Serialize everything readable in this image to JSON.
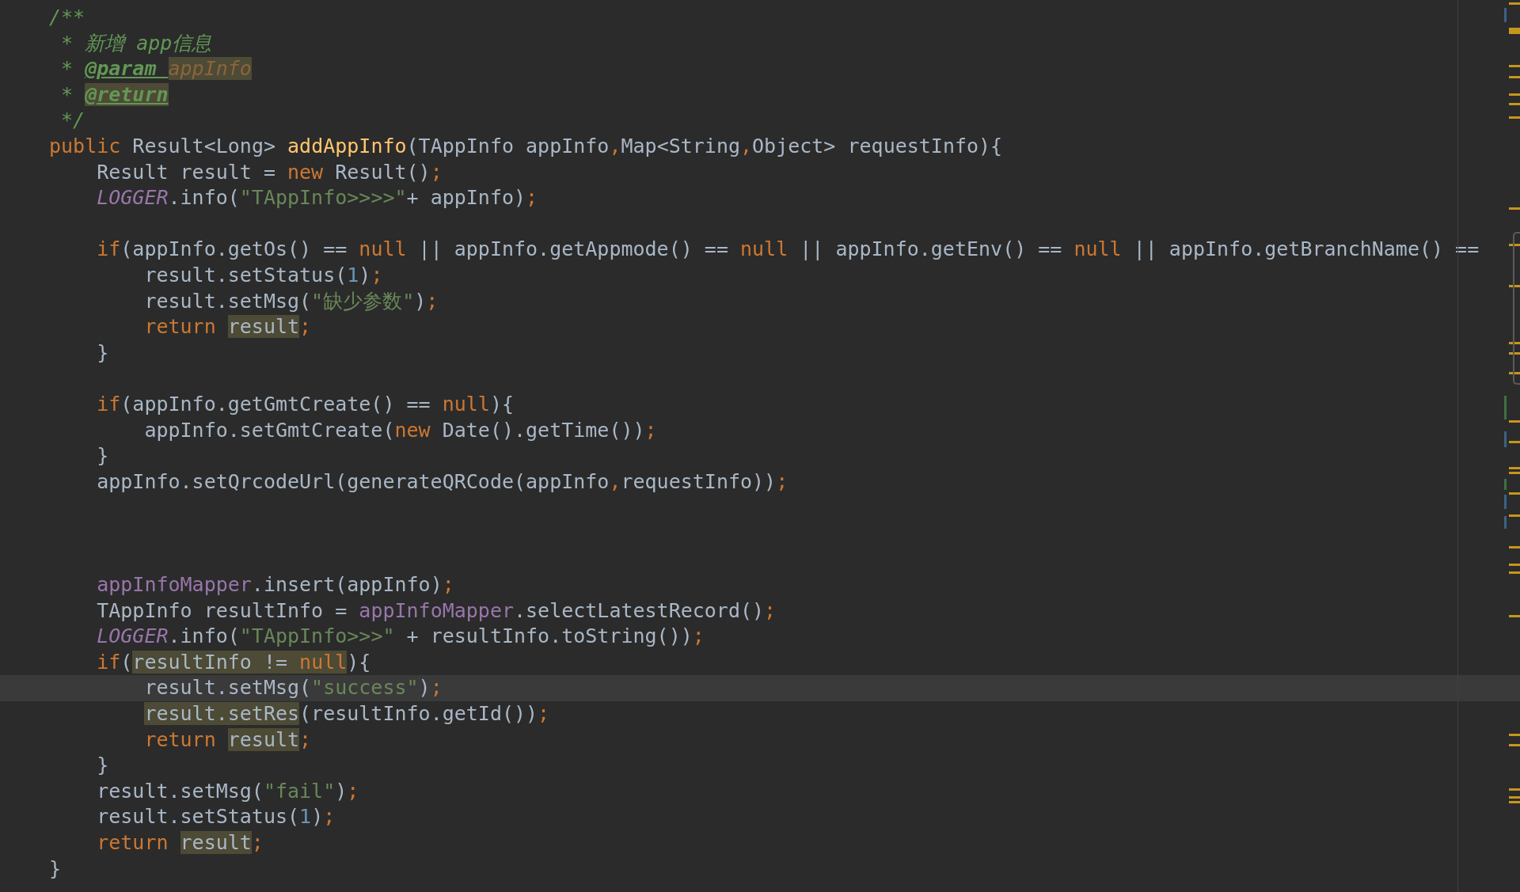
{
  "editor": {
    "lines": [
      {
        "current": false,
        "tokens": [
          {
            "kind": "doc",
            "text": "/**",
            "highlighted": false
          }
        ]
      },
      {
        "current": false,
        "tokens": [
          {
            "kind": "doc",
            "text": " * 新增 app信息",
            "highlighted": false
          }
        ]
      },
      {
        "current": false,
        "tokens": [
          {
            "kind": "doc",
            "text": " * ",
            "highlighted": false
          },
          {
            "kind": "tag",
            "text": "@param ",
            "highlighted": false
          },
          {
            "kind": "dparam",
            "text": "appInfo",
            "highlighted": true
          }
        ]
      },
      {
        "current": false,
        "tokens": [
          {
            "kind": "doc",
            "text": " * ",
            "highlighted": false
          },
          {
            "kind": "tag",
            "text": "@return",
            "highlighted": true
          }
        ]
      },
      {
        "current": false,
        "tokens": [
          {
            "kind": "doc",
            "text": " */",
            "highlighted": false
          }
        ]
      },
      {
        "current": false,
        "tokens": [
          {
            "kind": "kw",
            "text": "public",
            "highlighted": false
          },
          {
            "kind": "plain",
            "text": " Result<Long> ",
            "highlighted": false
          },
          {
            "kind": "decl",
            "text": "addAppInfo",
            "highlighted": false
          },
          {
            "kind": "plain",
            "text": "(TAppInfo appInfo",
            "highlighted": false
          },
          {
            "kind": "kw",
            "text": ",",
            "highlighted": false
          },
          {
            "kind": "plain",
            "text": "Map<String",
            "highlighted": false
          },
          {
            "kind": "kw",
            "text": ",",
            "highlighted": false
          },
          {
            "kind": "plain",
            "text": "Object> requestInfo){",
            "highlighted": false
          }
        ],
        "children": [
          {
            "current": false,
            "tokens": [
              {
                "kind": "plain",
                "text": "Result result = ",
                "highlighted": false
              },
              {
                "kind": "kw",
                "text": "new",
                "highlighted": false
              },
              {
                "kind": "plain",
                "text": " Result()",
                "highlighted": false
              },
              {
                "kind": "kw",
                "text": ";",
                "highlighted": false
              }
            ]
          },
          {
            "current": false,
            "tokens": [
              {
                "kind": "field",
                "text": "LOGGER",
                "highlighted": false
              },
              {
                "kind": "plain",
                "text": ".info(",
                "highlighted": false
              },
              {
                "kind": "str",
                "text": "\"TAppInfo>>>>\"",
                "highlighted": false
              },
              {
                "kind": "plain",
                "text": "+ appInfo)",
                "highlighted": false
              },
              {
                "kind": "kw",
                "text": ";",
                "highlighted": false
              }
            ]
          },
          {
            "current": false
          },
          {
            "current": false,
            "tokens": [
              {
                "kind": "kw",
                "text": "if",
                "highlighted": false
              },
              {
                "kind": "plain",
                "text": "(appInfo.getOs() == ",
                "highlighted": false
              },
              {
                "kind": "kw",
                "text": "null",
                "highlighted": false
              },
              {
                "kind": "plain",
                "text": " || appInfo.getAppmode() == ",
                "highlighted": false
              },
              {
                "kind": "kw",
                "text": "null",
                "highlighted": false
              },
              {
                "kind": "plain",
                "text": " || appInfo.getEnv() == ",
                "highlighted": false
              },
              {
                "kind": "kw",
                "text": "null",
                "highlighted": false
              },
              {
                "kind": "plain",
                "text": " || appInfo.getBranchName() ==",
                "highlighted": false
              }
            ],
            "children": [
              {
                "current": false,
                "tokens": [
                  {
                    "kind": "plain",
                    "text": "result.setStatus(",
                    "highlighted": false
                  },
                  {
                    "kind": "num",
                    "text": "1",
                    "highlighted": false
                  },
                  {
                    "kind": "plain",
                    "text": ")",
                    "highlighted": false
                  },
                  {
                    "kind": "kw",
                    "text": ";",
                    "highlighted": false
                  }
                ]
              },
              {
                "current": false,
                "tokens": [
                  {
                    "kind": "plain",
                    "text": "result.setMsg(",
                    "highlighted": false
                  },
                  {
                    "kind": "str",
                    "text": "\"缺少参数\"",
                    "highlighted": false
                  },
                  {
                    "kind": "plain",
                    "text": ")",
                    "highlighted": false
                  },
                  {
                    "kind": "kw",
                    "text": ";",
                    "highlighted": false
                  }
                ]
              },
              {
                "current": false,
                "tokens": [
                  {
                    "kind": "kw",
                    "text": "return ",
                    "highlighted": false
                  },
                  {
                    "kind": "plain",
                    "text": "result",
                    "highlighted": true
                  },
                  {
                    "kind": "kw",
                    "text": ";",
                    "highlighted": false
                  }
                ]
              }
            ]
          },
          {
            "current": false,
            "tokens": [
              {
                "kind": "plain",
                "text": "}",
                "highlighted": false
              }
            ]
          },
          {
            "current": false
          },
          {
            "current": false,
            "tokens": [
              {
                "kind": "kw",
                "text": "if",
                "highlighted": false
              },
              {
                "kind": "plain",
                "text": "(appInfo.getGmtCreate() == ",
                "highlighted": false
              },
              {
                "kind": "kw",
                "text": "null",
                "highlighted": false
              },
              {
                "kind": "plain",
                "text": "){",
                "highlighted": false
              }
            ],
            "children": [
              {
                "current": false,
                "tokens": [
                  {
                    "kind": "plain",
                    "text": "appInfo.setGmtCreate(",
                    "highlighted": false
                  },
                  {
                    "kind": "kw",
                    "text": "new",
                    "highlighted": false
                  },
                  {
                    "kind": "plain",
                    "text": " Date().getTime())",
                    "highlighted": false
                  },
                  {
                    "kind": "kw",
                    "text": ";",
                    "highlighted": false
                  }
                ]
              }
            ]
          },
          {
            "current": false,
            "tokens": [
              {
                "kind": "plain",
                "text": "}",
                "highlighted": false
              }
            ]
          },
          {
            "current": false,
            "tokens": [
              {
                "kind": "plain",
                "text": "appInfo.setQrcodeUrl(generateQRCode(appInfo",
                "highlighted": false
              },
              {
                "kind": "kw",
                "text": ",",
                "highlighted": false
              },
              {
                "kind": "plain",
                "text": "requestInfo))",
                "highlighted": false
              },
              {
                "kind": "kw",
                "text": ";",
                "highlighted": false
              }
            ]
          },
          {
            "current": false
          },
          {
            "current": false
          },
          {
            "current": false
          },
          {
            "current": false,
            "tokens": [
              {
                "kind": "member",
                "text": "appInfoMapper",
                "highlighted": false
              },
              {
                "kind": "plain",
                "text": ".insert(appInfo)",
                "highlighted": false
              },
              {
                "kind": "kw",
                "text": ";",
                "highlighted": false
              }
            ]
          },
          {
            "current": false,
            "tokens": [
              {
                "kind": "plain",
                "text": "TAppInfo resultInfo = ",
                "highlighted": false
              },
              {
                "kind": "member",
                "text": "appInfoMapper",
                "highlighted": false
              },
              {
                "kind": "plain",
                "text": ".selectLatestRecord()",
                "highlighted": false
              },
              {
                "kind": "kw",
                "text": ";",
                "highlighted": false
              }
            ]
          },
          {
            "current": false,
            "tokens": [
              {
                "kind": "field",
                "text": "LOGGER",
                "highlighted": false
              },
              {
                "kind": "plain",
                "text": ".info(",
                "highlighted": false
              },
              {
                "kind": "str",
                "text": "\"TAppInfo>>>\"",
                "highlighted": false
              },
              {
                "kind": "plain",
                "text": " + resultInfo.toString())",
                "highlighted": false
              },
              {
                "kind": "kw",
                "text": ";",
                "highlighted": false
              }
            ]
          },
          {
            "current": false,
            "tokens": [
              {
                "kind": "kw",
                "text": "if",
                "highlighted": false
              },
              {
                "kind": "plain",
                "text": "(",
                "highlighted": false
              },
              {
                "kind": "plain",
                "text": "resultInfo != ",
                "highlighted": true
              },
              {
                "kind": "kw",
                "text": "null",
                "highlighted": true
              },
              {
                "kind": "plain",
                "text": "){",
                "highlighted": false
              }
            ],
            "children": [
              {
                "current": true,
                "tokens": [
                  {
                    "kind": "plain",
                    "text": "result.setMsg(",
                    "highlighted": false
                  },
                  {
                    "kind": "str",
                    "text": "\"success\"",
                    "highlighted": false
                  },
                  {
                    "kind": "plain",
                    "text": ")",
                    "highlighted": false
                  },
                  {
                    "kind": "kw",
                    "text": ";",
                    "highlighted": false
                  }
                ]
              },
              {
                "current": false,
                "tokens": [
                  {
                    "kind": "plain",
                    "text": "result.setRes",
                    "highlighted": true
                  },
                  {
                    "kind": "plain",
                    "text": "(resultInfo.getId())",
                    "highlighted": false
                  },
                  {
                    "kind": "kw",
                    "text": ";",
                    "highlighted": false
                  }
                ]
              },
              {
                "current": false,
                "tokens": [
                  {
                    "kind": "kw",
                    "text": "return ",
                    "highlighted": false
                  },
                  {
                    "kind": "plain",
                    "text": "result",
                    "highlighted": true
                  },
                  {
                    "kind": "kw",
                    "text": ";",
                    "highlighted": false
                  }
                ]
              }
            ]
          },
          {
            "current": false,
            "tokens": [
              {
                "kind": "plain",
                "text": "}",
                "highlighted": false
              }
            ]
          },
          {
            "current": false,
            "tokens": [
              {
                "kind": "plain",
                "text": "result.setMsg(",
                "highlighted": false
              },
              {
                "kind": "str",
                "text": "\"fail\"",
                "highlighted": false
              },
              {
                "kind": "plain",
                "text": ")",
                "highlighted": false
              },
              {
                "kind": "kw",
                "text": ";",
                "highlighted": false
              }
            ]
          },
          {
            "current": false,
            "tokens": [
              {
                "kind": "plain",
                "text": "result.setStatus(",
                "highlighted": false
              },
              {
                "kind": "num",
                "text": "1",
                "highlighted": false
              },
              {
                "kind": "plain",
                "text": ")",
                "highlighted": false
              },
              {
                "kind": "kw",
                "text": ";",
                "highlighted": false
              }
            ]
          },
          {
            "current": false,
            "tokens": [
              {
                "kind": "kw",
                "text": "return ",
                "highlighted": false
              },
              {
                "kind": "plain",
                "text": "result",
                "highlighted": true
              },
              {
                "kind": "kw",
                "text": ";",
                "highlighted": false
              }
            ]
          }
        ]
      },
      {
        "current": false,
        "tokens": [
          {
            "kind": "plain",
            "text": "}",
            "highlighted": false
          }
        ]
      }
    ]
  }
}
